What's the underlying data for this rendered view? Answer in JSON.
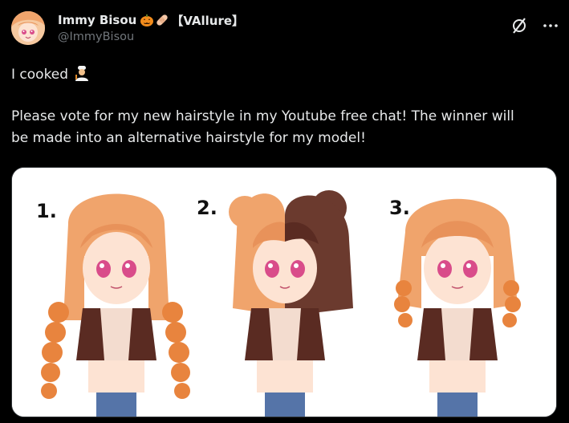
{
  "author": {
    "display_name": "Immy Bisou",
    "tag": "【VAllure】",
    "handle": "@ImmyBisou"
  },
  "actions": {
    "grok_icon": "grok-icon",
    "more_icon": "more-icon"
  },
  "tweet": {
    "line1": "I cooked",
    "line2": "Please vote for my new hairstyle in my Youtube free chat! The winner will",
    "line3": "be made into an alternative hairstyle for my model!"
  },
  "media": {
    "labels": [
      "1.",
      "2.",
      "3."
    ]
  },
  "colors": {
    "background": "#000000",
    "text": "#e7e9ea",
    "secondary": "#71767b",
    "hair_orange": "#f0a46c",
    "hair_brown": "#6b3a2e"
  }
}
